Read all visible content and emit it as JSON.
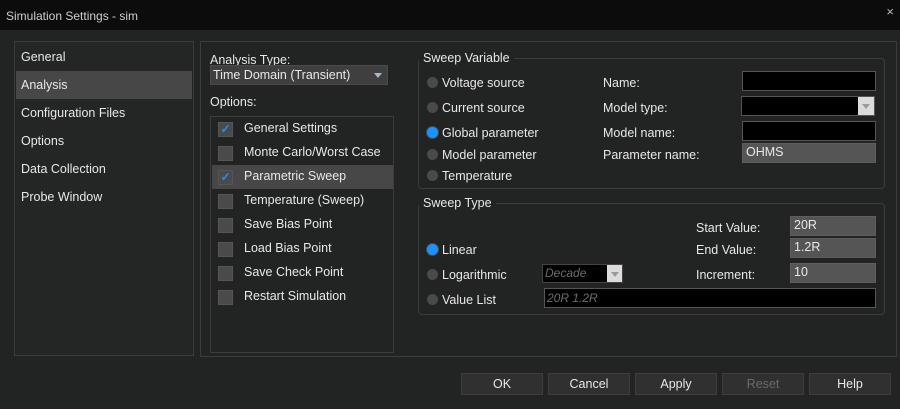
{
  "window": {
    "title": "Simulation Settings - sim",
    "close_icon": "×"
  },
  "sidebar": {
    "items": [
      {
        "label": "General"
      },
      {
        "label": "Analysis",
        "selected": true
      },
      {
        "label": "Configuration Files"
      },
      {
        "label": "Options"
      },
      {
        "label": "Data Collection"
      },
      {
        "label": "Probe Window"
      }
    ]
  },
  "analysis": {
    "type_label": "Analysis Type:",
    "type_value": "Time Domain (Transient)",
    "options_label": "Options:",
    "options": [
      {
        "label": "General Settings",
        "checked": true
      },
      {
        "label": "Monte Carlo/Worst Case",
        "checked": false
      },
      {
        "label": "Parametric Sweep",
        "checked": true
      },
      {
        "label": "Temperature (Sweep)",
        "checked": false
      },
      {
        "label": "Save Bias Point",
        "checked": false
      },
      {
        "label": "Load Bias Point",
        "checked": false
      },
      {
        "label": "Save Check Point",
        "checked": false
      },
      {
        "label": "Restart Simulation",
        "checked": false
      }
    ]
  },
  "sweep_variable": {
    "title": "Sweep Variable",
    "radios": [
      {
        "label": "Voltage source"
      },
      {
        "label": "Current source"
      },
      {
        "label": "Global parameter",
        "selected": true
      },
      {
        "label": "Model parameter"
      },
      {
        "label": "Temperature"
      }
    ],
    "name_label": "Name:",
    "name_value": "",
    "model_type_label": "Model type:",
    "model_type_value": "",
    "model_name_label": "Model name:",
    "model_name_value": "",
    "param_name_label": "Parameter name:",
    "param_name_value": "OHMS"
  },
  "sweep_type": {
    "title": "Sweep Type",
    "radios": [
      {
        "label": "Linear",
        "selected": true
      },
      {
        "label": "Logarithmic"
      },
      {
        "label": "Value List"
      }
    ],
    "log_scale_value": "Decade",
    "value_list_placeholder": "20R 1.2R",
    "start_label": "Start Value:",
    "start_value": "20R",
    "end_label": "End Value:",
    "end_value": "1.2R",
    "increment_label": "Increment:",
    "increment_value": "10"
  },
  "buttons": {
    "ok": "OK",
    "cancel": "Cancel",
    "apply": "Apply",
    "reset": "Reset",
    "help": "Help"
  },
  "colors": {
    "accent": "#1e90ff",
    "background": "#222323",
    "selected": "#474747"
  }
}
